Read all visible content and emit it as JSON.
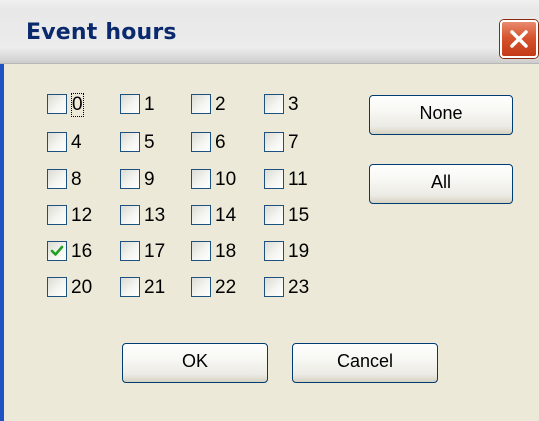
{
  "dialog": {
    "title": "Event hours"
  },
  "hours": [
    {
      "label": "0",
      "checked": false,
      "focused": true
    },
    {
      "label": "1",
      "checked": false
    },
    {
      "label": "2",
      "checked": false
    },
    {
      "label": "3",
      "checked": false
    },
    {
      "label": "4",
      "checked": false
    },
    {
      "label": "5",
      "checked": false
    },
    {
      "label": "6",
      "checked": false
    },
    {
      "label": "7",
      "checked": false
    },
    {
      "label": "8",
      "checked": false
    },
    {
      "label": "9",
      "checked": false
    },
    {
      "label": "10",
      "checked": false
    },
    {
      "label": "11",
      "checked": false
    },
    {
      "label": "12",
      "checked": false
    },
    {
      "label": "13",
      "checked": false
    },
    {
      "label": "14",
      "checked": false
    },
    {
      "label": "15",
      "checked": false
    },
    {
      "label": "16",
      "checked": true
    },
    {
      "label": "17",
      "checked": false
    },
    {
      "label": "18",
      "checked": false
    },
    {
      "label": "19",
      "checked": false
    },
    {
      "label": "20",
      "checked": false
    },
    {
      "label": "21",
      "checked": false
    },
    {
      "label": "22",
      "checked": false
    },
    {
      "label": "23",
      "checked": false
    }
  ],
  "buttons": {
    "none_label": "None",
    "all_label": "All",
    "ok_label": "OK",
    "cancel_label": "Cancel"
  },
  "colors": {
    "title_text": "#0b2a6e",
    "client_bg": "#ece9d8",
    "close_button": "#d6542e",
    "check_mark": "#21a121"
  }
}
